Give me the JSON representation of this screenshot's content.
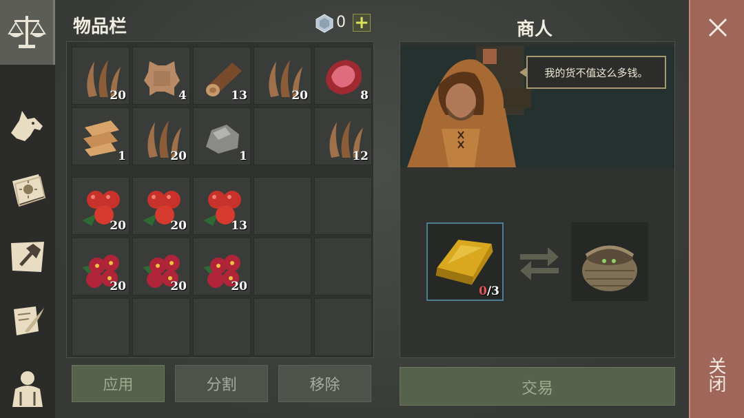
{
  "sidebar": {
    "items": [
      {
        "name": "merchant-scales-icon",
        "active": true
      },
      {
        "name": "wolf-icon",
        "active": false
      },
      {
        "name": "sun-book-icon",
        "active": false
      },
      {
        "name": "crafting-hammer-icon",
        "active": false
      },
      {
        "name": "scroll-quill-icon",
        "active": false
      },
      {
        "name": "character-icon",
        "active": false
      }
    ]
  },
  "inventory": {
    "title": "物品栏",
    "currency_amount": "0",
    "add_currency_label": "+",
    "cells": [
      {
        "item": "fiber",
        "count": "20"
      },
      {
        "item": "hide",
        "count": "4"
      },
      {
        "item": "log",
        "count": "13"
      },
      {
        "item": "fiber",
        "count": "20"
      },
      {
        "item": "raw-meat",
        "count": "8"
      },
      {
        "item": "cloth",
        "count": "1"
      },
      {
        "item": "fiber",
        "count": "20"
      },
      {
        "item": "stone",
        "count": "1"
      },
      {
        "item": "",
        "count": ""
      },
      {
        "item": "fiber",
        "count": "12"
      },
      {
        "item": "red-berries",
        "count": "20"
      },
      {
        "item": "red-berries",
        "count": "20"
      },
      {
        "item": "red-berries",
        "count": "13"
      },
      {
        "item": "",
        "count": ""
      },
      {
        "item": "",
        "count": ""
      },
      {
        "item": "dark-berries",
        "count": "20"
      },
      {
        "item": "dark-berries",
        "count": "20"
      },
      {
        "item": "dark-berries",
        "count": "20"
      },
      {
        "item": "",
        "count": ""
      },
      {
        "item": "",
        "count": ""
      },
      {
        "item": "",
        "count": ""
      },
      {
        "item": "",
        "count": ""
      },
      {
        "item": "",
        "count": ""
      },
      {
        "item": "",
        "count": ""
      },
      {
        "item": "",
        "count": ""
      }
    ],
    "buttons": {
      "apply": "应用",
      "split": "分割",
      "remove": "移除"
    }
  },
  "merchant": {
    "title": "商人",
    "speech": "我的货不值这么多钱。",
    "give_item": {
      "name": "gold-bar-icon",
      "have": "0",
      "need": "/3"
    },
    "receive_item": {
      "name": "basket-icon"
    },
    "trade_button": "交易"
  },
  "close": {
    "label": "关闭"
  },
  "colors": {
    "accent_green": "#56624b",
    "close_red": "#a0665a",
    "slot_highlight": "#4b7f94"
  }
}
